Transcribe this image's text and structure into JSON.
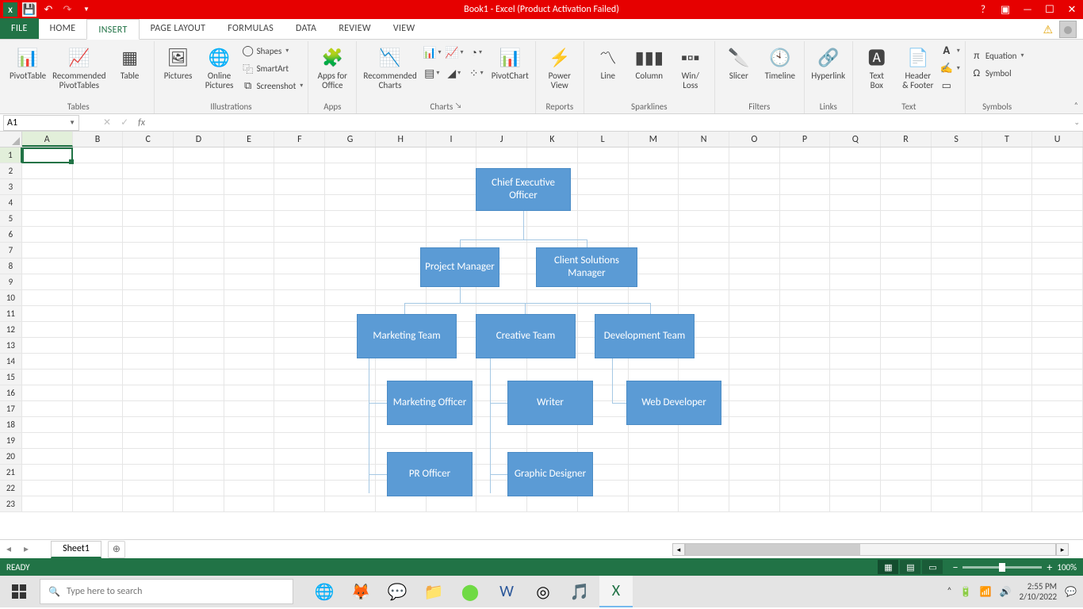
{
  "window": {
    "title": "Book1 - Excel (Product Activation Failed)"
  },
  "tabs": {
    "file": "FILE",
    "home": "HOME",
    "insert": "INSERT",
    "pagelayout": "PAGE LAYOUT",
    "formulas": "FORMULAS",
    "data": "DATA",
    "review": "REVIEW",
    "view": "VIEW"
  },
  "ribbon": {
    "tables": {
      "pivot": "PivotTable",
      "recpivot": "Recommended\nPivotTables",
      "table": "Table",
      "label": "Tables"
    },
    "illus": {
      "pictures": "Pictures",
      "online": "Online\nPictures",
      "shapes": "Shapes",
      "smartart": "SmartArt",
      "screenshot": "Screenshot",
      "label": "Illustrations"
    },
    "apps": {
      "apps": "Apps for\nOffice",
      "label": "Apps"
    },
    "charts": {
      "rec": "Recommended\nCharts",
      "pivotchart": "PivotChart",
      "label": "Charts"
    },
    "reports": {
      "powerview": "Power\nView",
      "label": "Reports"
    },
    "spark": {
      "line": "Line",
      "col": "Column",
      "winloss": "Win/\nLoss",
      "label": "Sparklines"
    },
    "filters": {
      "slicer": "Slicer",
      "timeline": "Timeline",
      "label": "Filters"
    },
    "links": {
      "hyper": "Hyperlink",
      "label": "Links"
    },
    "text": {
      "textbox": "Text\nBox",
      "hf": "Header\n& Footer",
      "label": "Text"
    },
    "symbols": {
      "eq": "Equation",
      "sym": "Symbol",
      "label": "Symbols"
    }
  },
  "namebox": {
    "value": "A1"
  },
  "columns": [
    "A",
    "B",
    "C",
    "D",
    "E",
    "F",
    "G",
    "H",
    "I",
    "J",
    "K",
    "L",
    "M",
    "N",
    "O",
    "P",
    "Q",
    "R",
    "S",
    "T",
    "U"
  ],
  "rowcount": 23,
  "chart_data": {
    "type": "org",
    "nodes": {
      "ceo": "Chief Executive Officer",
      "pm": "Project Manager",
      "csm": "Client Solutions Manager",
      "mkt": "Marketing Team",
      "cre": "Creative Team",
      "dev": "Development Team",
      "mo": "Marketing Officer",
      "wr": "Writer",
      "wd": "Web Developer",
      "pr": "PR Officer",
      "gd": "Graphic Designer"
    },
    "edges": [
      [
        "ceo",
        "pm"
      ],
      [
        "ceo",
        "csm"
      ],
      [
        "pm",
        "mkt"
      ],
      [
        "pm",
        "cre"
      ],
      [
        "pm",
        "dev"
      ],
      [
        "mkt",
        "mo"
      ],
      [
        "mkt",
        "pr"
      ],
      [
        "cre",
        "wr"
      ],
      [
        "cre",
        "gd"
      ],
      [
        "dev",
        "wd"
      ]
    ]
  },
  "sheettab": {
    "name": "Sheet1"
  },
  "status": {
    "ready": "READY",
    "zoom": "100%"
  },
  "taskbar": {
    "search_placeholder": "Type here to search",
    "time": "2:55 PM",
    "date": "2/10/2022"
  }
}
